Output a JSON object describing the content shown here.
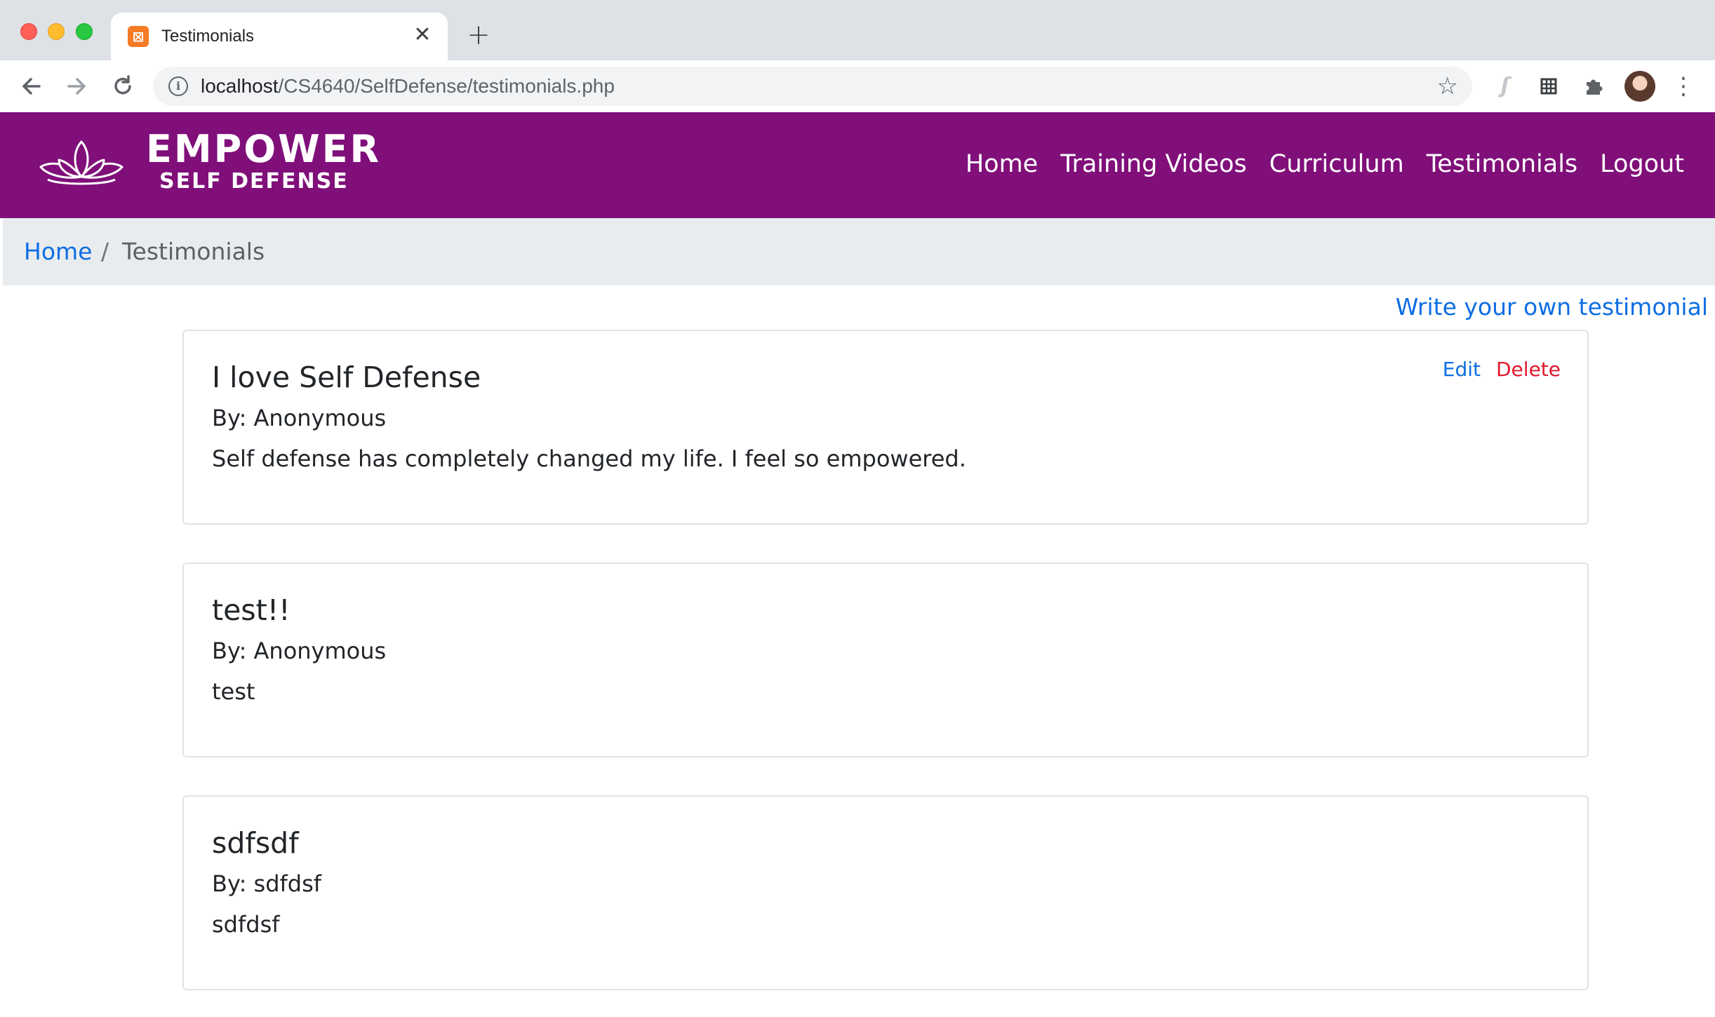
{
  "browser": {
    "tab_title": "Testimonials",
    "close_glyph": "✕",
    "new_tab_glyph": "+",
    "url_host": "localhost",
    "url_path": "/CS4640/SelfDefense/testimonials.php",
    "icons": [
      "back-arrow-icon",
      "forward-arrow-icon",
      "reload-icon",
      "site-info-icon",
      "bookmark-star-icon",
      "extension-icon",
      "grid-extension-icon",
      "puzzle-icon",
      "profile-avatar",
      "menu-kebab-icon"
    ]
  },
  "site": {
    "brand_top": "EMPOWER",
    "brand_bottom": "SELF DEFENSE",
    "nav": [
      "Home",
      "Training Videos",
      "Curriculum",
      "Testimonials",
      "Logout"
    ],
    "nav_color": "#800f7a"
  },
  "breadcrumb": {
    "home": "Home",
    "separator": "/",
    "current": "Testimonials"
  },
  "write_link": "Write your own testimonial",
  "testimonials": [
    {
      "title": "I love Self Defense",
      "author": "By: Anonymous",
      "body": "Self defense has completely changed my life. I feel so empowered.",
      "edit_label": "Edit",
      "delete_label": "Delete"
    },
    {
      "title": "test!!",
      "author": "By: Anonymous",
      "body": "test"
    },
    {
      "title": "sdfsdf",
      "author": "By: sdfdsf",
      "body": "sdfdsf"
    }
  ],
  "colors": {
    "link": "#0d6ee3",
    "delete": "#e0182d",
    "breadcrumb_bg": "#e9ecef"
  }
}
